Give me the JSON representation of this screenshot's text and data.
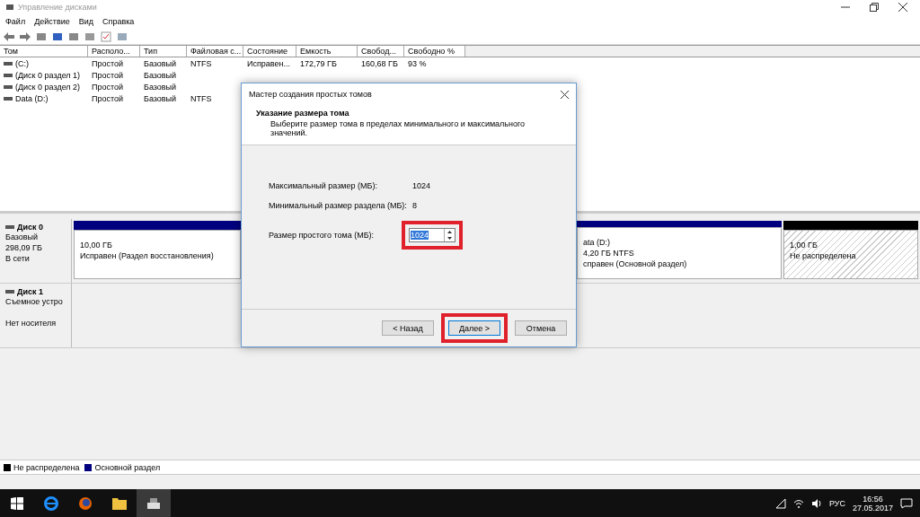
{
  "window": {
    "title": "Управление дисками"
  },
  "menu": [
    "Файл",
    "Действие",
    "Вид",
    "Справка"
  ],
  "table": {
    "columns": [
      "Том",
      "Располо...",
      "Тип",
      "Файловая с...",
      "Состояние",
      "Емкость",
      "Свобод...",
      "Свободно %"
    ],
    "rows": [
      [
        "(C:)",
        "Простой",
        "Базовый",
        "NTFS",
        "Исправен...",
        "172,79 ГБ",
        "160,68 ГБ",
        "93 %"
      ],
      [
        "(Диск 0 раздел 1)",
        "Простой",
        "Базовый",
        "",
        "",
        "",
        "",
        ""
      ],
      [
        "(Диск 0 раздел 2)",
        "Простой",
        "Базовый",
        "",
        "",
        "",
        "",
        ""
      ],
      [
        "Data (D:)",
        "Простой",
        "Базовый",
        "NTFS",
        "",
        "",
        "",
        ""
      ]
    ]
  },
  "disks": [
    {
      "name": "Диск 0",
      "lines": [
        "Базовый",
        "298,09 ГБ",
        "В сети"
      ],
      "partitions": [
        {
          "kind": "primary",
          "lines": [
            "10,00 ГБ",
            "Исправен (Раздел восстановления)"
          ]
        },
        {
          "kind": "hidden"
        },
        {
          "kind": "primary",
          "lines": [
            "ata  (D:)",
            "4,20 ГБ NTFS",
            "справен (Основной раздел)"
          ]
        },
        {
          "kind": "unallocated",
          "lines": [
            "1,00 ГБ",
            "Не распределена"
          ]
        }
      ]
    },
    {
      "name": "Диск 1",
      "lines": [
        "Съемное устро"
      ],
      "status": "Нет носителя"
    }
  ],
  "legend": [
    {
      "label": "Не распределена",
      "color": "#000000"
    },
    {
      "label": "Основной раздел",
      "color": "#00007f"
    }
  ],
  "dialog": {
    "title": "Мастер создания простых томов",
    "heading": "Указание размера тома",
    "description": "Выберите размер тома в пределах минимального и максимального значений.",
    "fields": [
      {
        "label": "Максимальный размер (МБ):",
        "value": "1024"
      },
      {
        "label": "Минимальный размер раздела (МБ):",
        "value": "8"
      }
    ],
    "size_label": "Размер простого тома (МБ):",
    "size_value": "1024",
    "buttons": [
      {
        "label": "< Назад",
        "highlighted": false
      },
      {
        "label": "Далее >",
        "highlighted": true
      },
      {
        "label": "Отмена",
        "highlighted": false
      }
    ]
  },
  "taskbar": {
    "language": "РУС",
    "time": "16:56",
    "date": "27.05.2017"
  }
}
